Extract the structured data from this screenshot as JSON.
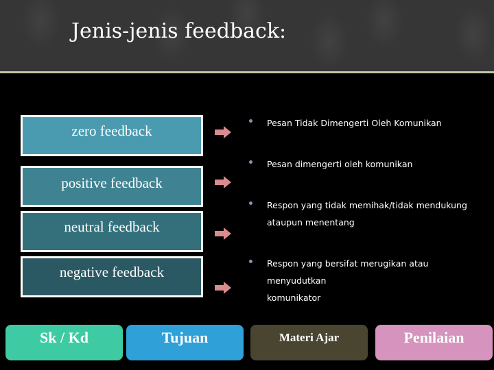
{
  "title": "Jenis-jenis feedback:",
  "feedback_types": [
    {
      "label": "zero feedback",
      "color": "#4a9bb0"
    },
    {
      "label": "positive feedback",
      "color": "#3f8392"
    },
    {
      "label": "neutral feedback",
      "color": "#33707c"
    },
    {
      "label": "negative feedback",
      "color": "#2b5963"
    }
  ],
  "descriptions": [
    {
      "line1": "Pesan Tidak Dimengerti Oleh Komunikan",
      "line2": ""
    },
    {
      "line1": "Pesan dimengerti oleh komunikan",
      "line2": ""
    },
    {
      "line1": "Respon yang tidak memihak/tidak mendukung",
      "line2": "ataupun menentang"
    },
    {
      "line1": "Respon yang bersifat merugikan atau menyudutkan",
      "line2": "komunikator"
    }
  ],
  "icons": {
    "arrow": "arrow-right-icon",
    "bullet": "bullet-icon"
  },
  "arrow_color": "#d98b8f",
  "nav": [
    {
      "label": "Sk / Kd",
      "color": "#3ecba3"
    },
    {
      "label": "Tujuan",
      "color": "#2fa0d8"
    },
    {
      "label": "Materi Ajar",
      "color": "#4a4530"
    },
    {
      "label": "Penilaian",
      "color": "#d593bd"
    }
  ]
}
